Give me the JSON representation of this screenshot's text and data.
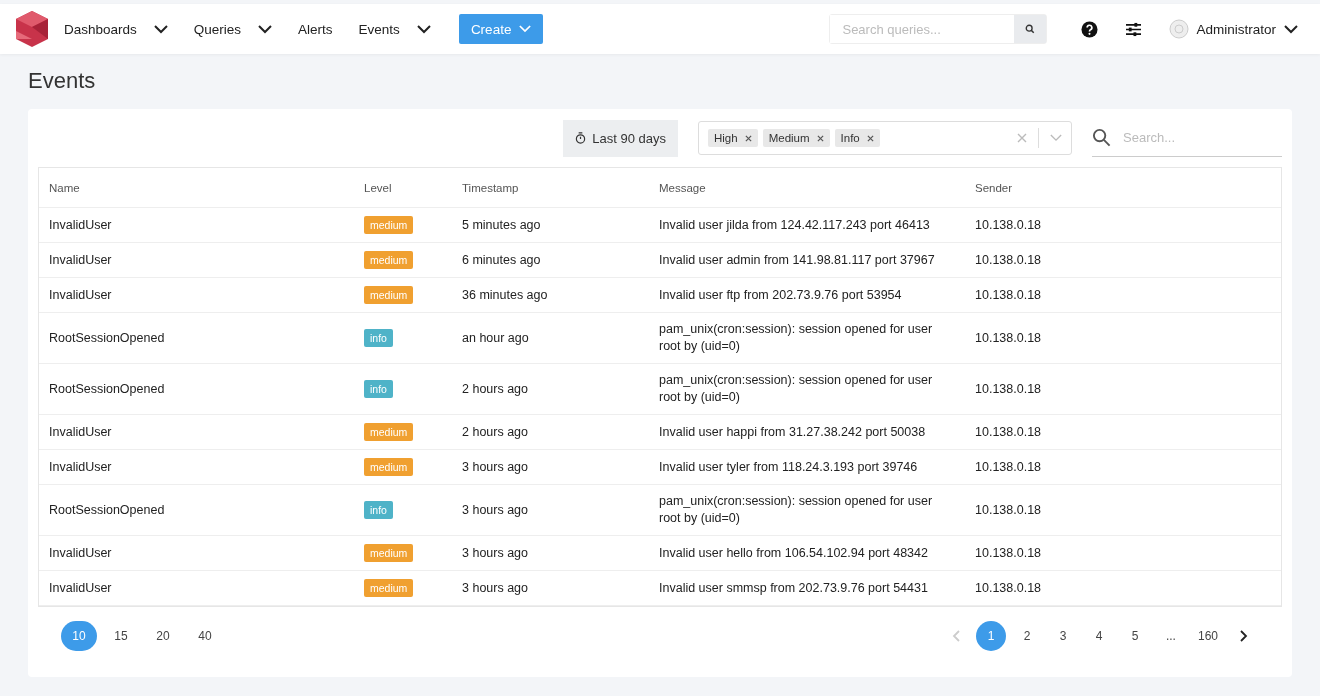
{
  "nav": {
    "items": [
      {
        "label": "Dashboards",
        "kind": "dropdown"
      },
      {
        "label": "Queries",
        "kind": "dropdown"
      },
      {
        "label": "Alerts",
        "kind": "link"
      },
      {
        "label": "Events",
        "kind": "dropdown"
      }
    ],
    "create_button": "Create",
    "search": {
      "placeholder": "Search queries..."
    },
    "user": "Administrator"
  },
  "page_title": "Events",
  "filters": {
    "time_range": "Last 90 days",
    "tags": [
      "High",
      "Medium",
      "Info"
    ],
    "search": {
      "placeholder": "Search..."
    }
  },
  "table": {
    "columns": [
      "Name",
      "Level",
      "Timestamp",
      "Message",
      "Sender"
    ],
    "rows": [
      {
        "name": "InvalidUser",
        "level": "medium",
        "color": "#f0a030",
        "timestamp": "5 minutes ago",
        "message": "Invalid user jilda from 124.42.117.243 port 46413",
        "sender": "10.138.0.18"
      },
      {
        "name": "InvalidUser",
        "level": "medium",
        "color": "#f0a030",
        "timestamp": "6 minutes ago",
        "message": "Invalid user admin from 141.98.81.117 port 37967",
        "sender": "10.138.0.18"
      },
      {
        "name": "InvalidUser",
        "level": "medium",
        "color": "#f0a030",
        "timestamp": "36 minutes ago",
        "message": "Invalid user ftp from 202.73.9.76 port 53954",
        "sender": "10.138.0.18"
      },
      {
        "name": "RootSessionOpened",
        "level": "info",
        "color": "#4fb3c8",
        "timestamp": "an hour ago",
        "message": "pam_unix(cron:session): session opened for user root by (uid=0)",
        "sender": "10.138.0.18"
      },
      {
        "name": "RootSessionOpened",
        "level": "info",
        "color": "#4fb3c8",
        "timestamp": "2 hours ago",
        "message": "pam_unix(cron:session): session opened for user root by (uid=0)",
        "sender": "10.138.0.18"
      },
      {
        "name": "InvalidUser",
        "level": "medium",
        "color": "#f0a030",
        "timestamp": "2 hours ago",
        "message": "Invalid user happi from 31.27.38.242 port 50038",
        "sender": "10.138.0.18"
      },
      {
        "name": "InvalidUser",
        "level": "medium",
        "color": "#f0a030",
        "timestamp": "3 hours ago",
        "message": "Invalid user tyler from 118.24.3.193 port 39746",
        "sender": "10.138.0.18"
      },
      {
        "name": "RootSessionOpened",
        "level": "info",
        "color": "#4fb3c8",
        "timestamp": "3 hours ago",
        "message": "pam_unix(cron:session): session opened for user root by (uid=0)",
        "sender": "10.138.0.18"
      },
      {
        "name": "InvalidUser",
        "level": "medium",
        "color": "#f0a030",
        "timestamp": "3 hours ago",
        "message": "Invalid user hello from 106.54.102.94 port 48342",
        "sender": "10.138.0.18"
      },
      {
        "name": "InvalidUser",
        "level": "medium",
        "color": "#f0a030",
        "timestamp": "3 hours ago",
        "message": "Invalid user smmsp from 202.73.9.76 port 54431",
        "sender": "10.138.0.18"
      }
    ]
  },
  "page_sizes": [
    {
      "label": "10",
      "selected": true
    },
    {
      "label": "15",
      "selected": false
    },
    {
      "label": "20",
      "selected": false
    },
    {
      "label": "40",
      "selected": false
    }
  ],
  "pagination": {
    "prev_disabled": true,
    "next_disabled": false,
    "pages": [
      {
        "label": "1",
        "selected": true
      },
      {
        "label": "2",
        "selected": false
      },
      {
        "label": "3",
        "selected": false
      },
      {
        "label": "4",
        "selected": false
      },
      {
        "label": "5",
        "selected": false
      },
      {
        "label": "...",
        "selected": false
      },
      {
        "label": "160",
        "selected": false
      }
    ]
  }
}
